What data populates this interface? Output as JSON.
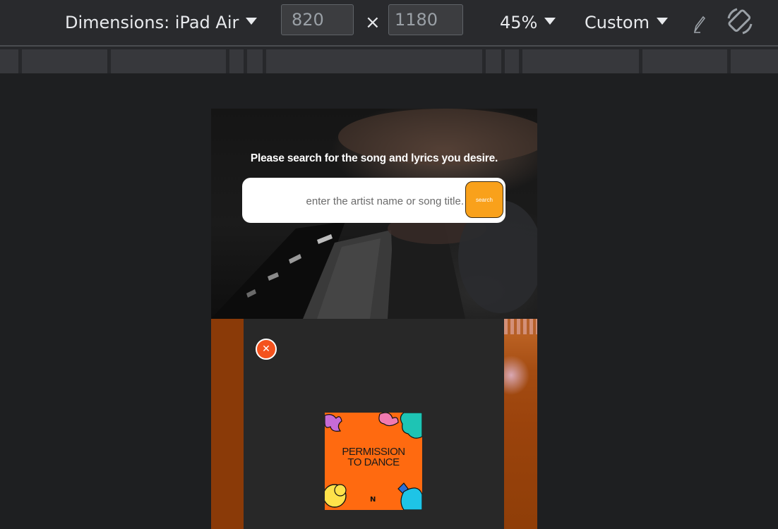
{
  "toolbar": {
    "dimensions_label": "Dimensions: iPad Air",
    "width_value": "820",
    "height_value": "1180",
    "times_symbol": "×",
    "zoom_label": "45%",
    "throttle_label": "Custom",
    "icons": [
      "caret-down-icon",
      "pen-icon",
      "rotate-icon"
    ]
  },
  "page": {
    "hero_title": "Please search for the song and lyrics you desire.",
    "search_placeholder": "enter the artist name or song title.",
    "search_button": "search",
    "close_symbol": "✕",
    "album_title_line1": "PERMISSION",
    "album_title_line2": "TO DANCE",
    "album_logo": "N"
  },
  "colors": {
    "accent_orange": "#f9a11b",
    "close_red": "#f4521d",
    "album_orange": "#ff6a10"
  }
}
